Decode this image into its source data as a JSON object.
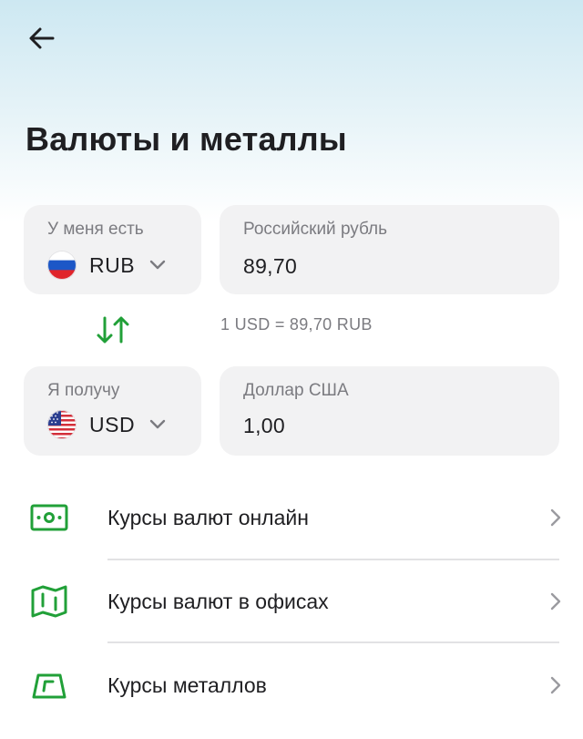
{
  "header": {
    "back_icon": "arrow-left-icon",
    "title": "Валюты и металлы"
  },
  "converter": {
    "from": {
      "label": "У меня есть",
      "code": "RUB",
      "flag_icon": "russia-flag-icon",
      "currency_name": "Российский рубль",
      "amount": "89,70"
    },
    "swap_icon": "swap-arrows-icon",
    "rate": "1 USD = 89,70 RUB",
    "to": {
      "label": "Я получу",
      "code": "USD",
      "flag_icon": "usa-flag-icon",
      "currency_name": "Доллар США",
      "amount": "1,00"
    }
  },
  "menu": {
    "items": [
      {
        "label": "Курсы валют онлайн",
        "icon": "banknote-icon"
      },
      {
        "label": "Курсы валют в офисах",
        "icon": "map-icon"
      },
      {
        "label": "Курсы металлов",
        "icon": "gold-bar-icon"
      }
    ]
  },
  "colors": {
    "accent_green": "#21a038",
    "card_bg": "#f2f2f3",
    "text_primary": "#1f1f22",
    "text_secondary": "#7b7b80",
    "header_gradient_top": "#cde8f2"
  }
}
